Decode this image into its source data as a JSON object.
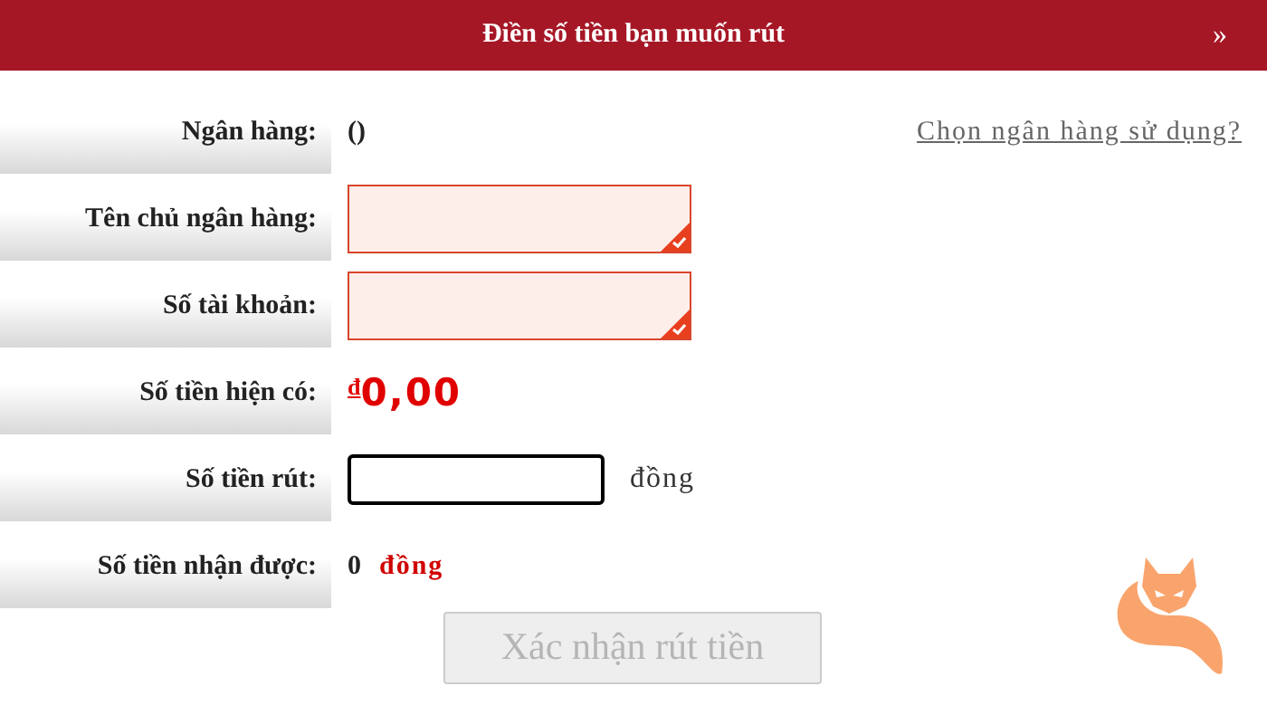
{
  "header": {
    "title": "Điền số tiền bạn muốn rút",
    "expand_icon": "»"
  },
  "rows": [
    {
      "kind": "bank",
      "label": "Ngân hàng:",
      "value": "()",
      "link": "Chọn ngân hàng sử dụng?"
    },
    {
      "kind": "field",
      "label": "Tên chủ ngân hàng:",
      "error": true
    },
    {
      "kind": "field",
      "label": "Số tài khoản:",
      "error": true
    },
    {
      "kind": "balance",
      "label": "Số tiền hiện có:",
      "currency": "đ",
      "value": "0,00"
    },
    {
      "kind": "amount",
      "label": "Số tiền rút:",
      "focused": true,
      "unit": "đồng"
    },
    {
      "kind": "received",
      "label": "Số tiền nhận được:",
      "value": "0",
      "unit": "đồng"
    }
  ],
  "submit": {
    "label": "Xác nhận rút tiền",
    "disabled": true
  }
}
